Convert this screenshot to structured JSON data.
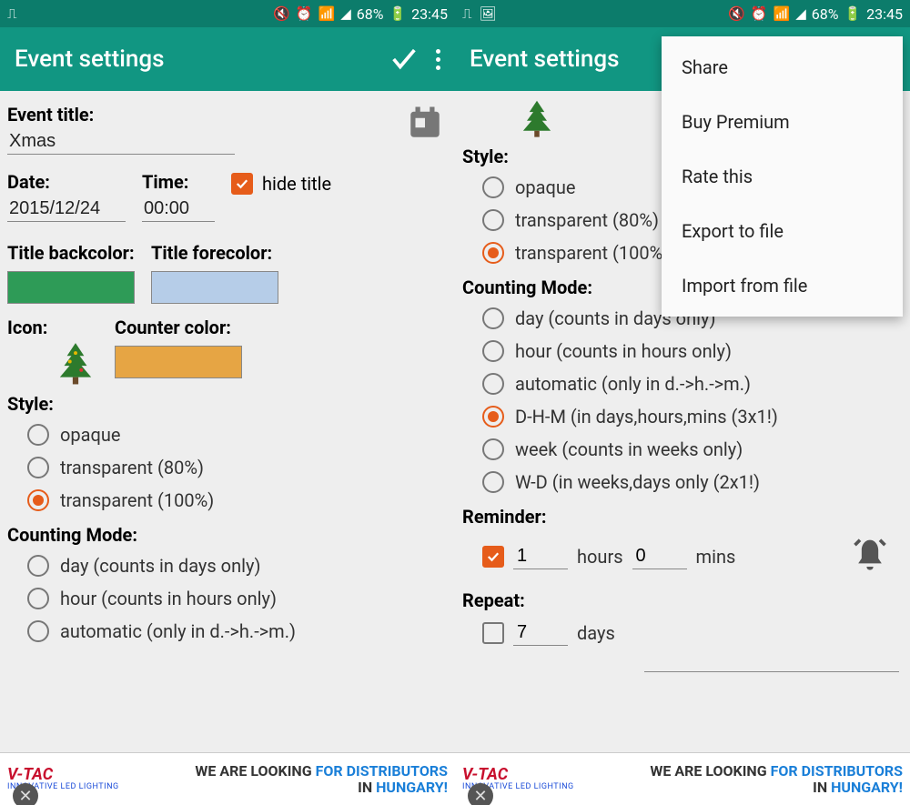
{
  "status": {
    "battery": "68%",
    "time": "23:45"
  },
  "appbar": {
    "title": "Event settings"
  },
  "left": {
    "event_title_label": "Event title:",
    "event_title_value": "Xmas",
    "date_label": "Date:",
    "date_value": "2015/12/24",
    "time_label": "Time:",
    "time_value": "00:00",
    "hide_title_label": "hide title",
    "title_backcolor_label": "Title backcolor:",
    "title_backcolor": "#2e9b57",
    "title_forecolor_label": "Title forecolor:",
    "title_forecolor": "#b6cde8",
    "icon_label": "Icon:",
    "counter_color_label": "Counter color:",
    "counter_color": "#e6a544",
    "style_label": "Style:",
    "style_options": [
      {
        "label": "opaque",
        "selected": false
      },
      {
        "label": "transparent (80%)",
        "selected": false
      },
      {
        "label": "transparent (100%)",
        "selected": true
      }
    ],
    "counting_label": "Counting Mode:",
    "counting_options": [
      {
        "label": "day (counts in days only)",
        "selected": false
      },
      {
        "label": "hour (counts in hours only)",
        "selected": false
      },
      {
        "label": "automatic (only in d.->h.->m.)",
        "selected": false
      }
    ]
  },
  "right": {
    "style_label": "Style:",
    "style_options": [
      {
        "label": "opaque",
        "selected": false
      },
      {
        "label": "transparent (80%)",
        "selected": false
      },
      {
        "label": "transparent (100%)",
        "selected": true
      }
    ],
    "counting_label": "Counting Mode:",
    "counting_options": [
      {
        "label": "day (counts in days only)",
        "selected": false
      },
      {
        "label": "hour (counts in hours only)",
        "selected": false
      },
      {
        "label": "automatic (only in d.->h.->m.)",
        "selected": false
      },
      {
        "label": "D-H-M (in days,hours,mins (3x1!)",
        "selected": true
      },
      {
        "label": "week (counts in weeks only)",
        "selected": false
      },
      {
        "label": "W-D (in weeks,days only (2x1!)",
        "selected": false
      }
    ],
    "reminder_label": "Reminder:",
    "reminder_checked": true,
    "reminder_hours": "1",
    "reminder_hours_label": "hours",
    "reminder_mins": "0",
    "reminder_mins_label": "mins",
    "repeat_label": "Repeat:",
    "repeat_checked": false,
    "repeat_value": "7",
    "repeat_unit": "days"
  },
  "menu": {
    "items": [
      "Share",
      "Buy Premium",
      "Rate this",
      "Export to file",
      "Import from file"
    ]
  },
  "ad": {
    "brand": "V-TAC",
    "sub": "INNOVATIVE LED LIGHTING",
    "line1a": "WE ARE LOOKING ",
    "line1b": "FOR DISTRIBUTORS",
    "line2a": "IN ",
    "line2b": "HUNGARY!"
  }
}
